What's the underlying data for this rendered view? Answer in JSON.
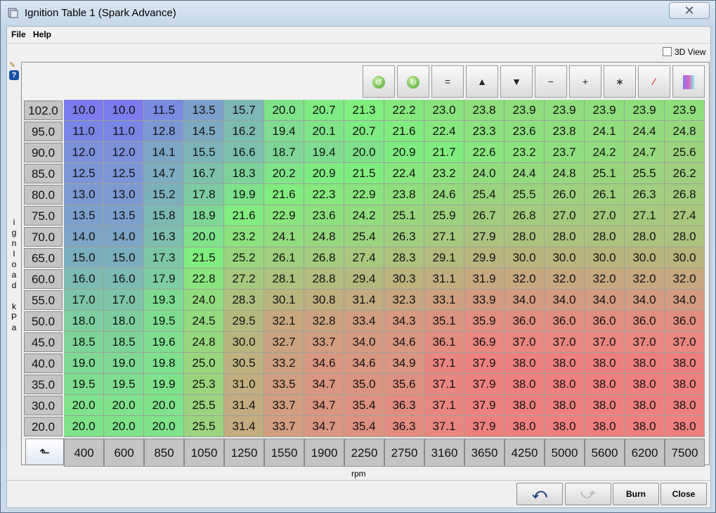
{
  "window": {
    "title": "Ignition Table 1 (Spark Advance)"
  },
  "menu": {
    "file": "File",
    "help": "Help"
  },
  "view3d_label": "3D View",
  "y_axis_label": [
    "i",
    "g",
    "n",
    "l",
    "o",
    "a",
    "d",
    "",
    "k",
    "P",
    "a"
  ],
  "x_axis_label": "rpm",
  "toolbar": [
    "undo-green-icon",
    "redo-green-icon",
    "equals-icon",
    "increment-icon",
    "decrement-icon",
    "minus-icon",
    "plus-icon",
    "multiply-icon",
    "pen-icon",
    "color-scale-icon"
  ],
  "toolbar_symbols": [
    "↺",
    "↻",
    "=",
    "▲",
    "▼",
    "−",
    "+",
    "∗",
    "∕",
    "█"
  ],
  "rows": [
    "102.0",
    "95.0",
    "90.0",
    "85.0",
    "80.0",
    "75.0",
    "70.0",
    "65.0",
    "60.0",
    "55.0",
    "50.0",
    "45.0",
    "40.0",
    "35.0",
    "30.0",
    "20.0"
  ],
  "cols": [
    "400",
    "600",
    "850",
    "1050",
    "1250",
    "1550",
    "1900",
    "2250",
    "2750",
    "3160",
    "3650",
    "4250",
    "5000",
    "5600",
    "6200",
    "7500"
  ],
  "table": [
    [
      "10.0",
      "10.0",
      "11.5",
      "13.5",
      "15.7",
      "20.0",
      "20.7",
      "21.3",
      "22.2",
      "23.0",
      "23.8",
      "23.9",
      "23.9",
      "23.9",
      "23.9",
      "23.9"
    ],
    [
      "11.0",
      "11.0",
      "12.8",
      "14.5",
      "16.2",
      "19.4",
      "20.1",
      "20.7",
      "21.6",
      "22.4",
      "23.3",
      "23.6",
      "23.8",
      "24.1",
      "24.4",
      "24.8"
    ],
    [
      "12.0",
      "12.0",
      "14.1",
      "15.5",
      "16.6",
      "18.7",
      "19.4",
      "20.0",
      "20.9",
      "21.7",
      "22.6",
      "23.2",
      "23.7",
      "24.2",
      "24.7",
      "25.6"
    ],
    [
      "12.5",
      "12.5",
      "14.7",
      "16.7",
      "18.3",
      "20.2",
      "20.9",
      "21.5",
      "22.4",
      "23.2",
      "24.0",
      "24.4",
      "24.8",
      "25.1",
      "25.5",
      "26.2"
    ],
    [
      "13.0",
      "13.0",
      "15.2",
      "17.8",
      "19.9",
      "21.6",
      "22.3",
      "22.9",
      "23.8",
      "24.6",
      "25.4",
      "25.5",
      "26.0",
      "26.1",
      "26.3",
      "26.8"
    ],
    [
      "13.5",
      "13.5",
      "15.8",
      "18.9",
      "21.6",
      "22.9",
      "23.6",
      "24.2",
      "25.1",
      "25.9",
      "26.7",
      "26.8",
      "27.0",
      "27.0",
      "27.1",
      "27.4"
    ],
    [
      "14.0",
      "14.0",
      "16.3",
      "20.0",
      "23.2",
      "24.1",
      "24.8",
      "25.4",
      "26.3",
      "27.1",
      "27.9",
      "28.0",
      "28.0",
      "28.0",
      "28.0",
      "28.0"
    ],
    [
      "15.0",
      "15.0",
      "17.3",
      "21.5",
      "25.2",
      "26.1",
      "26.8",
      "27.4",
      "28.3",
      "29.1",
      "29.9",
      "30.0",
      "30.0",
      "30.0",
      "30.0",
      "30.0"
    ],
    [
      "16.0",
      "16.0",
      "17.9",
      "22.8",
      "27.2",
      "28.1",
      "28.8",
      "29.4",
      "30.3",
      "31.1",
      "31.9",
      "32.0",
      "32.0",
      "32.0",
      "32.0",
      "32.0"
    ],
    [
      "17.0",
      "17.0",
      "19.3",
      "24.0",
      "28.3",
      "30.1",
      "30.8",
      "31.4",
      "32.3",
      "33.1",
      "33.9",
      "34.0",
      "34.0",
      "34.0",
      "34.0",
      "34.0"
    ],
    [
      "18.0",
      "18.0",
      "19.5",
      "24.5",
      "29.5",
      "32.1",
      "32.8",
      "33.4",
      "34.3",
      "35.1",
      "35.9",
      "36.0",
      "36.0",
      "36.0",
      "36.0",
      "36.0"
    ],
    [
      "18.5",
      "18.5",
      "19.6",
      "24.8",
      "30.0",
      "32.7",
      "33.7",
      "34.0",
      "34.6",
      "36.1",
      "36.9",
      "37.0",
      "37.0",
      "37.0",
      "37.0",
      "37.0"
    ],
    [
      "19.0",
      "19.0",
      "19.8",
      "25.0",
      "30.5",
      "33.2",
      "34.6",
      "34.6",
      "34.9",
      "37.1",
      "37.9",
      "38.0",
      "38.0",
      "38.0",
      "38.0",
      "38.0"
    ],
    [
      "19.5",
      "19.5",
      "19.9",
      "25.3",
      "31.0",
      "33.5",
      "34.7",
      "35.0",
      "35.6",
      "37.1",
      "37.9",
      "38.0",
      "38.0",
      "38.0",
      "38.0",
      "38.0"
    ],
    [
      "20.0",
      "20.0",
      "20.0",
      "25.5",
      "31.4",
      "33.7",
      "34.7",
      "35.4",
      "36.3",
      "37.1",
      "37.9",
      "38.0",
      "38.0",
      "38.0",
      "38.0",
      "38.0"
    ],
    [
      "20.0",
      "20.0",
      "20.0",
      "25.5",
      "31.4",
      "33.7",
      "34.7",
      "35.4",
      "36.3",
      "37.1",
      "37.9",
      "38.0",
      "38.0",
      "38.0",
      "38.0",
      "38.0"
    ]
  ],
  "color_scale": {
    "min": 10.0,
    "max": 38.0,
    "low": "#7b7bf0",
    "mid": "#7ef07e",
    "high": "#f08080"
  },
  "buttons": {
    "burn": "Burn",
    "close": "Close"
  }
}
